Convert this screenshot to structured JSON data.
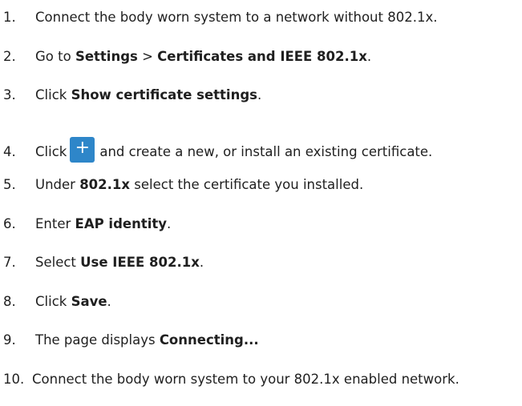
{
  "steps": [
    {
      "number": "1.",
      "text": "Connect the body worn system to a network without 802.1x."
    },
    {
      "number": "2.",
      "prefix": "Go to ",
      "bold1": "Settings",
      "mid": " > ",
      "bold2": "Certificates and IEEE 802.1x",
      "suffix": "."
    },
    {
      "number": "3.",
      "prefix": "Click ",
      "bold": "Show certificate settings",
      "suffix": "."
    },
    {
      "number": "4.",
      "prefix": "Click",
      "button_icon": "+",
      "suffix": "and create a new, or install an existing certificate."
    },
    {
      "number": "5.",
      "prefix": "Under ",
      "bold": "802.1x",
      "suffix": " select the certificate you installed."
    },
    {
      "number": "6.",
      "prefix": "Enter ",
      "bold": "EAP identity",
      "suffix": "."
    },
    {
      "number": "7.",
      "prefix": "Select ",
      "bold": "Use IEEE 802.1x",
      "suffix": "."
    },
    {
      "number": "8.",
      "prefix": "Click ",
      "bold": "Save",
      "suffix": "."
    },
    {
      "number": "9.",
      "prefix": "The page displays ",
      "bold": "Connecting..."
    },
    {
      "number": "10.",
      "text": "Connect the body worn system to your 802.1x enabled network."
    }
  ],
  "colors": {
    "add_button": "#2e86c9"
  }
}
